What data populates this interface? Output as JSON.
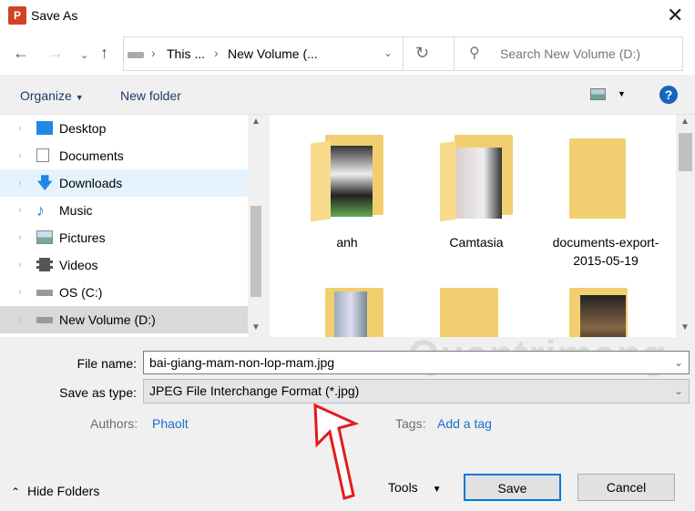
{
  "window": {
    "title": "Save As",
    "app_icon": "P"
  },
  "address": {
    "crumbs": [
      "This ...",
      "New Volume (..."
    ],
    "search_placeholder": "Search New Volume (D:)"
  },
  "toolbar": {
    "organize": "Organize",
    "new_folder": "New folder",
    "help": "?"
  },
  "nav": {
    "items": [
      {
        "label": "Desktop",
        "icon": "desktop-icon"
      },
      {
        "label": "Documents",
        "icon": "documents-icon"
      },
      {
        "label": "Downloads",
        "icon": "downloads-icon",
        "hover": true
      },
      {
        "label": "Music",
        "icon": "music-icon"
      },
      {
        "label": "Pictures",
        "icon": "pictures-icon"
      },
      {
        "label": "Videos",
        "icon": "videos-icon"
      },
      {
        "label": "OS (C:)",
        "icon": "drive-icon"
      },
      {
        "label": "New Volume (D:)",
        "icon": "drive-icon",
        "selected": true
      }
    ]
  },
  "files": [
    {
      "name": "anh"
    },
    {
      "name": "Camtasia"
    },
    {
      "name": "documents-export-2015-05-19"
    },
    {
      "name": ""
    },
    {
      "name": ""
    },
    {
      "name": ""
    }
  ],
  "form": {
    "file_name_label": "File name:",
    "file_name": "bai-giang-mam-non-lop-mam.jpg",
    "type_label": "Save as type:",
    "type": "JPEG File Interchange Format (*.jpg)",
    "authors_label": "Authors:",
    "authors": "Phaolt",
    "tags_label": "Tags:",
    "tags": "Add a tag"
  },
  "footer": {
    "hide_folders": "Hide Folders",
    "tools": "Tools",
    "save": "Save",
    "cancel": "Cancel"
  },
  "watermark": "Quantrimang"
}
